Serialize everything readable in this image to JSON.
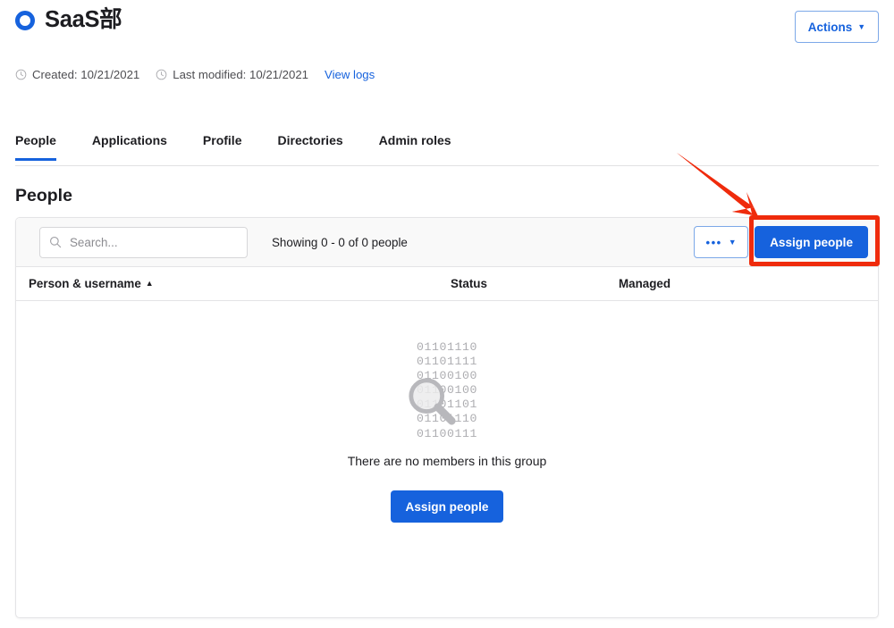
{
  "header": {
    "group_icon": "group-ring-icon",
    "title": "SaaS部",
    "actions_label": "Actions",
    "actions_caret": "▼",
    "meta": {
      "created_label": "Created: 10/21/2021",
      "modified_label": "Last modified: 10/21/2021",
      "view_logs_label": "View logs",
      "clock_icon": "clock-icon"
    }
  },
  "tabs": [
    {
      "label": "People",
      "active": true
    },
    {
      "label": "Applications",
      "active": false
    },
    {
      "label": "Profile",
      "active": false
    },
    {
      "label": "Directories",
      "active": false
    },
    {
      "label": "Admin roles",
      "active": false
    }
  ],
  "section": {
    "title": "People"
  },
  "toolbar": {
    "search_placeholder": "Search...",
    "search_value": "",
    "search_icon": "search-icon",
    "showing_text": "Showing 0 - 0 of 0 people",
    "more_dots": "•••",
    "more_caret": "▼",
    "assign_people_label": "Assign people"
  },
  "table": {
    "columns": [
      {
        "label": "Person & username",
        "sort": "▲"
      },
      {
        "label": "Status",
        "sort": ""
      },
      {
        "label": "Managed",
        "sort": ""
      }
    ],
    "rows": []
  },
  "empty_state": {
    "illustration_icon": "magnifier-over-binary-icon",
    "binary_rows": [
      "01101110",
      "01101111",
      "01100100",
      "01100100",
      "01101101",
      "01101110",
      "01100111"
    ],
    "message": "There are no members in this group",
    "button_label": "Assign people"
  },
  "annotations": {
    "arrow_icon": "red-arrow-icon",
    "highlight_icon": "red-highlight-box",
    "color": "#ef2b0c"
  },
  "colors": {
    "primary_blue": "#1662dd",
    "text": "#1d1d21",
    "muted": "#4e4e52",
    "toolbar_bg": "#f9f9f9",
    "border": "#e4e4e6",
    "binary_gray": "#adadb1"
  }
}
